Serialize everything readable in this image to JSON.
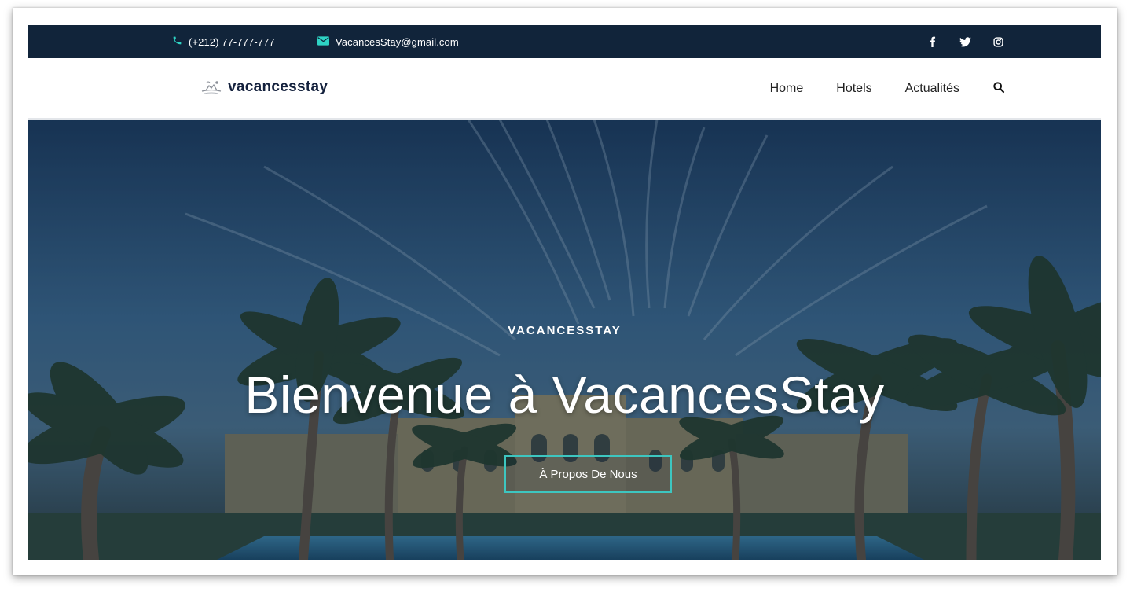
{
  "topbar": {
    "phone": "(+212) 77-777-777",
    "email": "VacancesStay@gmail.com",
    "accent_color": "#2ed3c4",
    "background_color": "#11243a",
    "socials": [
      "facebook-icon",
      "twitter-icon",
      "instagram-icon"
    ]
  },
  "navbar": {
    "brand": "vacancesstay",
    "menu": [
      {
        "label": "Home"
      },
      {
        "label": "Hotels"
      },
      {
        "label": "Actualités"
      }
    ],
    "search_icon": "search-icon"
  },
  "hero": {
    "eyebrow": "VACANCESSTAY",
    "headline": "Bienvenue à VacancesStay",
    "cta_label": "À Propos De Nous",
    "cta_border_color": "#3dc6c0"
  }
}
